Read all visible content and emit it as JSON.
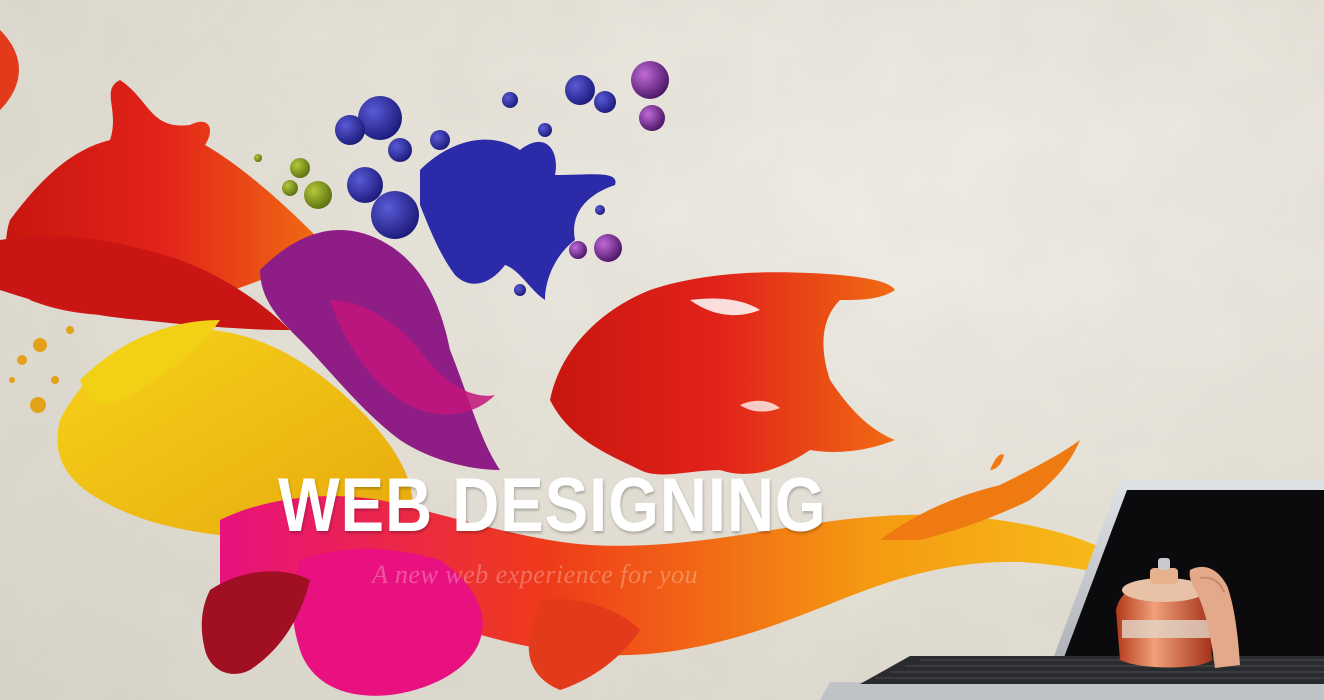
{
  "banner": {
    "headline": "WEB DESIGNING",
    "tagline": "A new web experience for you"
  },
  "colors": {
    "background": "#e6e2d8",
    "headline": "#ffffff",
    "paint_red": "#e2231a",
    "paint_orange": "#f06b12",
    "paint_yellow": "#f2c20f",
    "paint_magenta": "#e8117f",
    "paint_blue": "#2b2aa8",
    "paint_purple": "#6a1f8a",
    "laptop_body": "#c9ccd1",
    "laptop_screen": "#0b0b0d"
  },
  "icons": [
    "paint-splash",
    "laptop",
    "spray-can",
    "hand"
  ]
}
